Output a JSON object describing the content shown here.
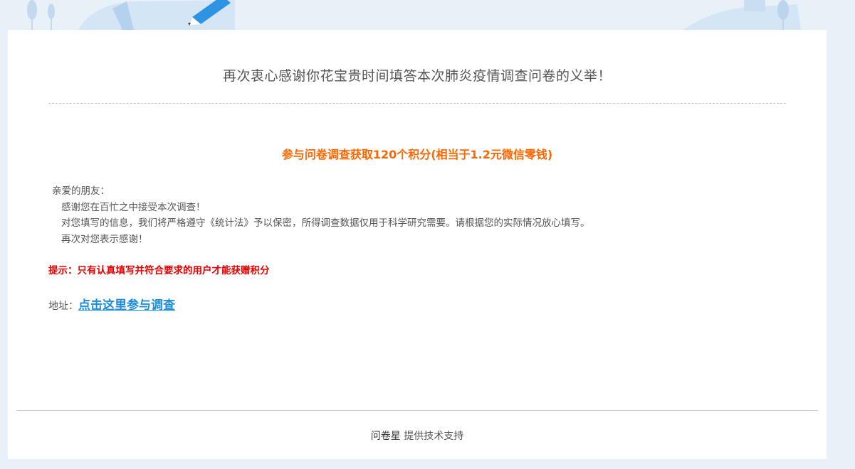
{
  "header": {
    "thanks_message": "再次衷心感谢你花宝贵时间填答本次肺炎疫情调查问卷的义举！"
  },
  "reward": {
    "text": "参与问卷调查获取120个积分(相当于1.2元微信零钱)"
  },
  "letter": {
    "greeting": "亲爱的朋友：",
    "line1": "感谢您在百忙之中接受本次调查！",
    "line2": "对您填写的信息，我们将严格遵守《统计法》予以保密，所得调查数据仅用于科学研究需要。请根据您的实际情况放心填写。",
    "line3": "再次对您表示感谢！"
  },
  "notice": {
    "text": "提示：只有认真填写并符合要求的用户才能获赠积分"
  },
  "address": {
    "label": "地址：",
    "link_text": "点击这里参与调查"
  },
  "footer": {
    "brand": "问卷星",
    "support_text": " 提供技术支持"
  },
  "colors": {
    "reward": "#ff6600",
    "notice": "#e60000",
    "link": "#1a8ddd",
    "page_bg": "#e9f1f8"
  }
}
